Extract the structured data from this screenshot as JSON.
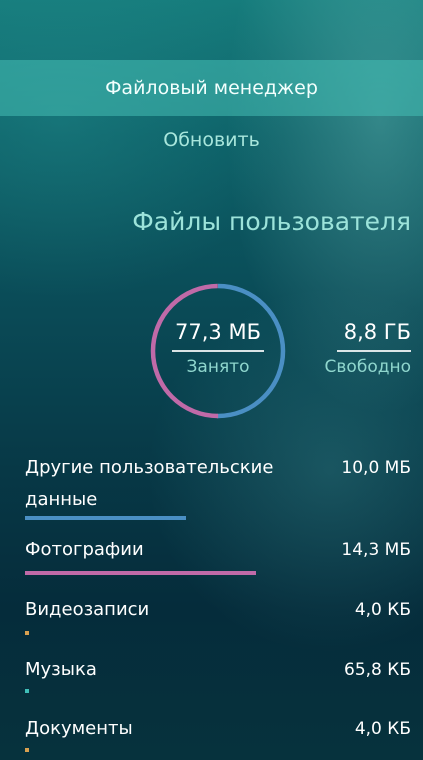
{
  "menu": {
    "active_label": "Файловый менеджер",
    "refresh_label": "Обновить"
  },
  "header": {
    "title": "Файлы пользователя"
  },
  "summary": {
    "used_value": "77,3 МБ",
    "used_label": "Занято",
    "free_value": "8,8 ГБ",
    "free_label": "Свободно",
    "used_color": "#c06aa8",
    "free_color": "#4a8fc4"
  },
  "categories": [
    {
      "label": "Другие пользовательские данные",
      "value": "10,0 МБ",
      "color": "#4a8fc4",
      "fraction": 0.39
    },
    {
      "label": "Фотографии",
      "value": "14,3 МБ",
      "color": "#c06aa8",
      "fraction": 0.56
    },
    {
      "label": "Видеозаписи",
      "value": "4,0 КБ",
      "color": "#d8a050",
      "fraction": 0.0
    },
    {
      "label": "Музыка",
      "value": "65,8 КБ",
      "color": "#3fbfb8",
      "fraction": 0.0
    },
    {
      "label": "Документы",
      "value": "4,0 КБ",
      "color": "#d8a050",
      "fraction": 0.0
    }
  ]
}
